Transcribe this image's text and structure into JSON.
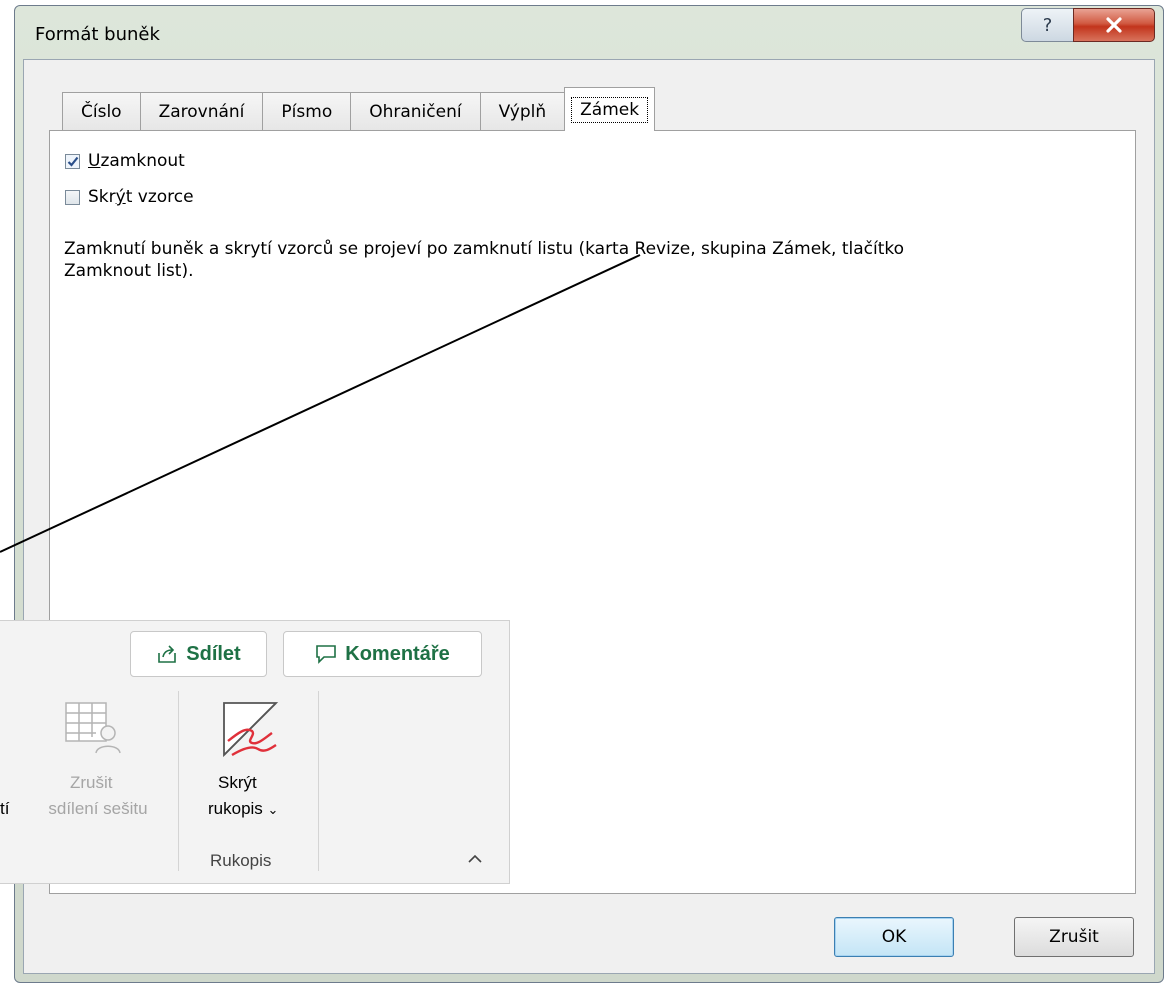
{
  "dialog": {
    "title": "Formát buněk",
    "help_glyph": "?",
    "tabs": [
      {
        "label": "Číslo"
      },
      {
        "label": "Zarovnání"
      },
      {
        "label": "Písmo"
      },
      {
        "label": "Ohraničení"
      },
      {
        "label": "Výplň"
      },
      {
        "label": "Zámek",
        "active": true
      }
    ],
    "checkboxes": {
      "lock": {
        "label_underline": "U",
        "label_rest": "zamknout",
        "checked": true
      },
      "hide": {
        "label_pre": "Skr",
        "label_underline": "ý",
        "label_rest": "t vzorce",
        "checked": false
      }
    },
    "note_line1": "Zamknutí buněk a skrytí vzorců se projeví po zamknutí listu (karta Revize, skupina Zámek, tlačítko",
    "note_line2": "Zamknout list).",
    "ok_label": "OK",
    "cancel_label": "Zrušit"
  },
  "ribbon": {
    "share_label": "Sdílet",
    "comments_label": "Komentáře",
    "cut_text": "tí",
    "unshare_line1": "Zrušit",
    "unshare_line2": "sdílení sešitu",
    "hide_ink_line1": "Skrýt",
    "hide_ink_line2": "rukopis",
    "group_label": "Rukopis",
    "accent_color": "#1e7145"
  }
}
